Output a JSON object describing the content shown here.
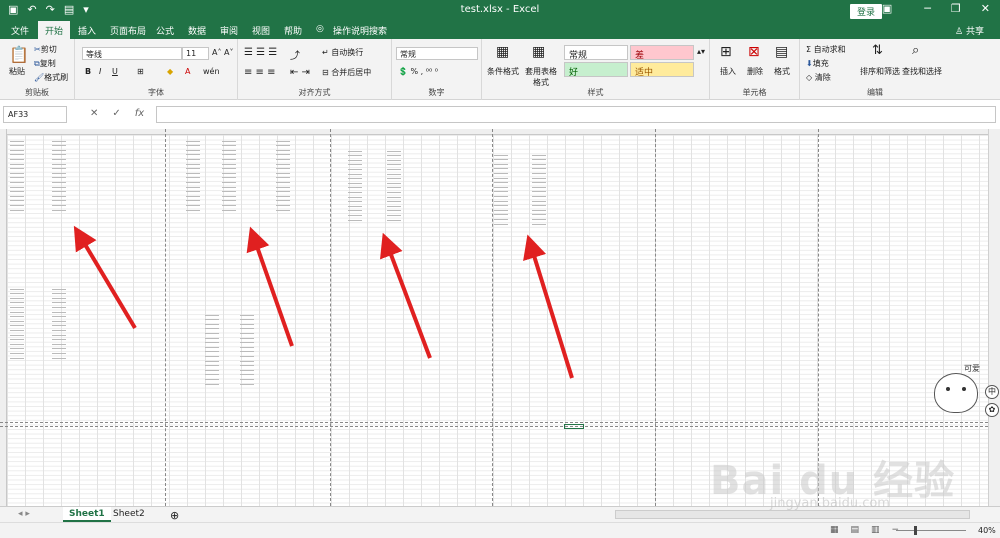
{
  "titlebar": {
    "title": "test.xlsx  -  Excel",
    "login": "登录"
  },
  "tabs": [
    "文件",
    "开始",
    "插入",
    "页面布局",
    "公式",
    "数据",
    "审阅",
    "视图",
    "帮助",
    "操作说明搜索"
  ],
  "share": "共享",
  "ribbon": {
    "clipboard": {
      "paste": "粘贴",
      "cut": "剪切",
      "copy": "复制",
      "format_painter": "格式刷",
      "label": "剪贴板"
    },
    "font": {
      "name": "等线",
      "size": "11",
      "label": "字体",
      "bold": "B",
      "italic": "I",
      "underline": "U"
    },
    "alignment": {
      "wrap": "自动换行",
      "merge": "合并后居中",
      "label": "对齐方式"
    },
    "number": {
      "format": "常规",
      "label": "数字"
    },
    "styles": {
      "cond": "条件格式",
      "table": "套用表格格式",
      "normal": "常规",
      "bad": "差",
      "good": "好",
      "neutral": "适中",
      "label": "样式"
    },
    "cells": {
      "insert": "插入",
      "delete": "删除",
      "format": "格式",
      "label": "单元格"
    },
    "editing": {
      "autosum": "自动求和",
      "fill": "填充",
      "clear": "清除",
      "sort": "排序和筛选",
      "find": "查找和选择",
      "label": "编辑"
    }
  },
  "formula": {
    "namebox": "AF33",
    "fx": "fx"
  },
  "sheets": {
    "s1": "Sheet1",
    "s2": "Sheet2"
  },
  "status": {
    "zoom": "40%"
  },
  "sticker": {
    "caption": "可爱"
  },
  "watermark": {
    "main": "Bai du 经验",
    "sub": "jingyan.baidu.com"
  },
  "colors": {
    "excel_green": "#217346",
    "arrow": "#e02020"
  }
}
